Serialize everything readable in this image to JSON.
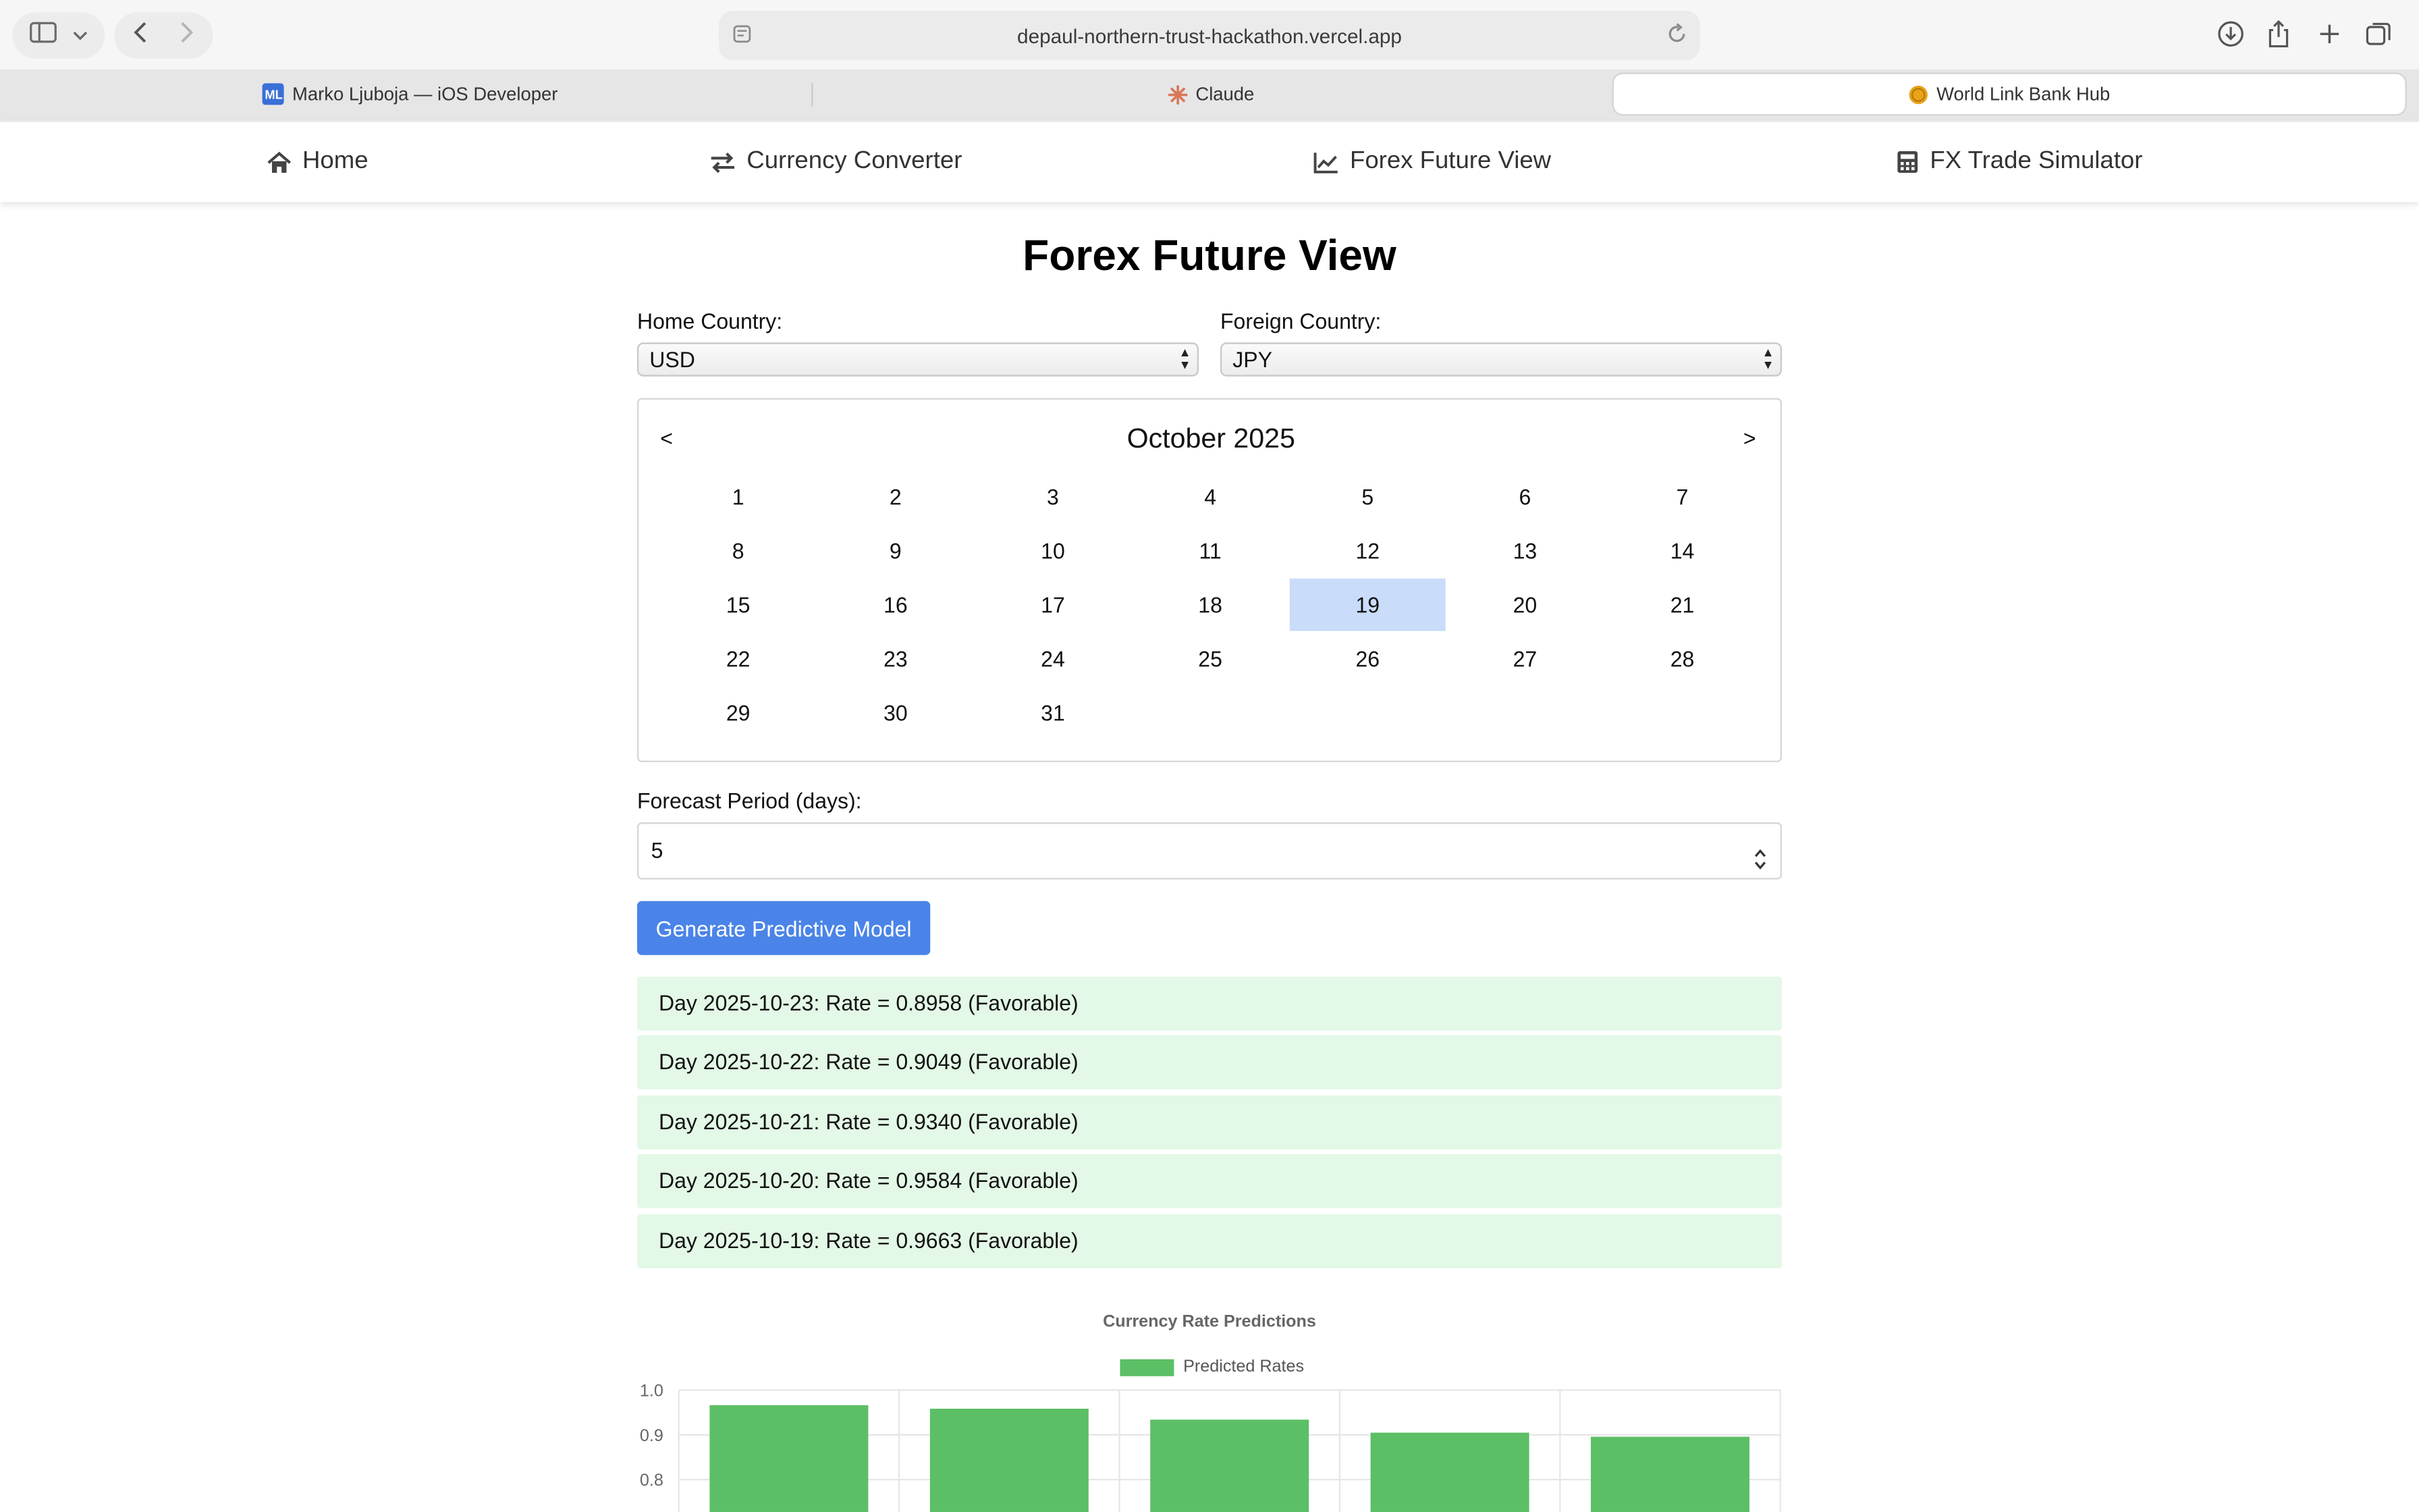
{
  "browser": {
    "url": "depaul-northern-trust-hackathon.vercel.app",
    "tabs": [
      {
        "label": "Marko Ljuboja — iOS Developer",
        "favicon": "ML",
        "active": false
      },
      {
        "label": "Claude",
        "favicon": "claude-spark-icon",
        "active": false
      },
      {
        "label": "World Link Bank Hub",
        "favicon": "coin-icon",
        "active": true
      }
    ]
  },
  "nav": {
    "items": [
      {
        "label": "Home",
        "icon": "home-icon"
      },
      {
        "label": "Currency Converter",
        "icon": "exchange-arrows-icon"
      },
      {
        "label": "Forex Future View",
        "icon": "line-chart-icon",
        "active": true
      },
      {
        "label": "FX Trade Simulator",
        "icon": "calculator-icon"
      }
    ]
  },
  "page": {
    "title": "Forex Future View",
    "home_country_label": "Home Country:",
    "home_country_value": "USD",
    "foreign_country_label": "Foreign Country:",
    "foreign_country_value": "JPY"
  },
  "calendar": {
    "month_label": "October 2025",
    "prev_label": "<",
    "next_label": ">",
    "days": [
      "1",
      "2",
      "3",
      "4",
      "5",
      "6",
      "7",
      "8",
      "9",
      "10",
      "11",
      "12",
      "13",
      "14",
      "15",
      "16",
      "17",
      "18",
      "19",
      "20",
      "21",
      "22",
      "23",
      "24",
      "25",
      "26",
      "27",
      "28",
      "29",
      "30",
      "31"
    ],
    "selected_day": "19"
  },
  "forecast": {
    "label": "Forecast Period (days):",
    "value": "5",
    "button_label": "Generate Predictive Model"
  },
  "results": [
    "Day 2025-10-23: Rate = 0.8958 (Favorable)",
    "Day 2025-10-22: Rate = 0.9049 (Favorable)",
    "Day 2025-10-21: Rate = 0.9340 (Favorable)",
    "Day 2025-10-20: Rate = 0.9584 (Favorable)",
    "Day 2025-10-19: Rate = 0.9663 (Favorable)"
  ],
  "colors": {
    "accent": "#4a84e8",
    "selected_day": "#c9dcf9",
    "result_bg": "#e3f8e6",
    "bar": "#5cbf65"
  },
  "chart_data": {
    "type": "bar",
    "title": "Currency Rate Predictions",
    "series": [
      {
        "name": "Predicted Rates",
        "values": [
          0.9663,
          0.9584,
          0.934,
          0.9049,
          0.8958
        ]
      }
    ],
    "yticks": [
      "1.0",
      "0.9",
      "0.8"
    ],
    "ylim": [
      0.75,
      1.0
    ],
    "grid": true,
    "legend": "top-center"
  }
}
